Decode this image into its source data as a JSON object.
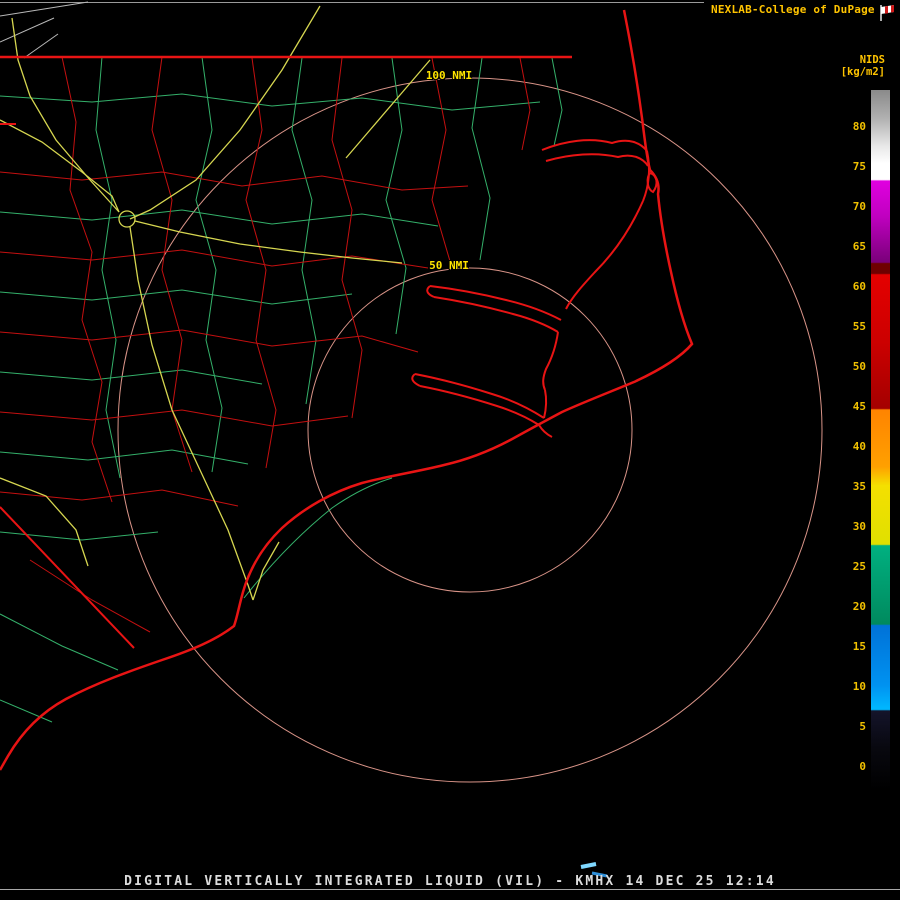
{
  "header": {
    "title": "NEXLAB-College of DuPage"
  },
  "colorbar": {
    "title": "NIDS",
    "units": "[kg/m2]",
    "ticks": [
      "80",
      "75",
      "70",
      "65",
      "60",
      "55",
      "50",
      "45",
      "40",
      "35",
      "30",
      "25",
      "20",
      "15",
      "10",
      "5",
      "0"
    ],
    "palette_top_to_bottom": [
      "#8a8a8a",
      "#ffffff",
      "#cc00cc",
      "#6e0000",
      "#cc0000",
      "#ff9000",
      "#e8e800",
      "#00a070",
      "#0080e0",
      "#00b8ff",
      "#000000"
    ]
  },
  "map": {
    "range_rings": [
      {
        "label": "100 NMI"
      },
      {
        "label": "50 NMI"
      }
    ],
    "colors": {
      "state_border_red": "#e81414",
      "road_network_red": "#c41010",
      "county_green": "#34b06a",
      "highway_yellow": "#d6d650",
      "range_ring": "#d99488",
      "echo_cyan": "#7fd8ff",
      "echo_blue": "#2e8fd8"
    }
  },
  "footer": {
    "title": "DIGITAL VERTICALLY INTEGRATED LIQUID (VIL) - KMHX 14 DEC 25 12:14",
    "product": "DIGITAL VERTICALLY INTEGRATED LIQUID (VIL)",
    "station": "KMHX",
    "datetime": "14 DEC 25 12:14"
  }
}
